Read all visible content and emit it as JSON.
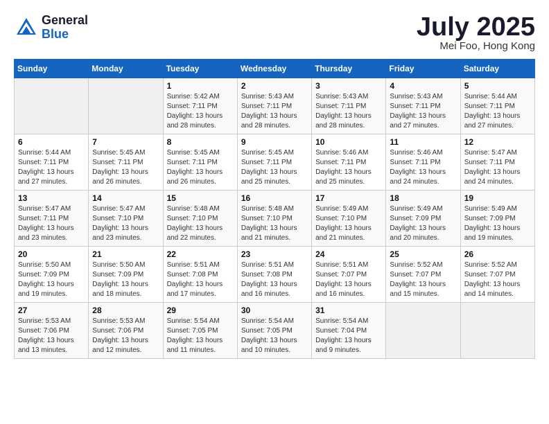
{
  "header": {
    "logo_general": "General",
    "logo_blue": "Blue",
    "month_title": "July 2025",
    "location": "Mei Foo, Hong Kong"
  },
  "weekdays": [
    "Sunday",
    "Monday",
    "Tuesday",
    "Wednesday",
    "Thursday",
    "Friday",
    "Saturday"
  ],
  "weeks": [
    [
      {
        "day": "",
        "info": ""
      },
      {
        "day": "",
        "info": ""
      },
      {
        "day": "1",
        "info": "Sunrise: 5:42 AM\nSunset: 7:11 PM\nDaylight: 13 hours and 28 minutes."
      },
      {
        "day": "2",
        "info": "Sunrise: 5:43 AM\nSunset: 7:11 PM\nDaylight: 13 hours and 28 minutes."
      },
      {
        "day": "3",
        "info": "Sunrise: 5:43 AM\nSunset: 7:11 PM\nDaylight: 13 hours and 28 minutes."
      },
      {
        "day": "4",
        "info": "Sunrise: 5:43 AM\nSunset: 7:11 PM\nDaylight: 13 hours and 27 minutes."
      },
      {
        "day": "5",
        "info": "Sunrise: 5:44 AM\nSunset: 7:11 PM\nDaylight: 13 hours and 27 minutes."
      }
    ],
    [
      {
        "day": "6",
        "info": "Sunrise: 5:44 AM\nSunset: 7:11 PM\nDaylight: 13 hours and 27 minutes."
      },
      {
        "day": "7",
        "info": "Sunrise: 5:45 AM\nSunset: 7:11 PM\nDaylight: 13 hours and 26 minutes."
      },
      {
        "day": "8",
        "info": "Sunrise: 5:45 AM\nSunset: 7:11 PM\nDaylight: 13 hours and 26 minutes."
      },
      {
        "day": "9",
        "info": "Sunrise: 5:45 AM\nSunset: 7:11 PM\nDaylight: 13 hours and 25 minutes."
      },
      {
        "day": "10",
        "info": "Sunrise: 5:46 AM\nSunset: 7:11 PM\nDaylight: 13 hours and 25 minutes."
      },
      {
        "day": "11",
        "info": "Sunrise: 5:46 AM\nSunset: 7:11 PM\nDaylight: 13 hours and 24 minutes."
      },
      {
        "day": "12",
        "info": "Sunrise: 5:47 AM\nSunset: 7:11 PM\nDaylight: 13 hours and 24 minutes."
      }
    ],
    [
      {
        "day": "13",
        "info": "Sunrise: 5:47 AM\nSunset: 7:11 PM\nDaylight: 13 hours and 23 minutes."
      },
      {
        "day": "14",
        "info": "Sunrise: 5:47 AM\nSunset: 7:10 PM\nDaylight: 13 hours and 23 minutes."
      },
      {
        "day": "15",
        "info": "Sunrise: 5:48 AM\nSunset: 7:10 PM\nDaylight: 13 hours and 22 minutes."
      },
      {
        "day": "16",
        "info": "Sunrise: 5:48 AM\nSunset: 7:10 PM\nDaylight: 13 hours and 21 minutes."
      },
      {
        "day": "17",
        "info": "Sunrise: 5:49 AM\nSunset: 7:10 PM\nDaylight: 13 hours and 21 minutes."
      },
      {
        "day": "18",
        "info": "Sunrise: 5:49 AM\nSunset: 7:09 PM\nDaylight: 13 hours and 20 minutes."
      },
      {
        "day": "19",
        "info": "Sunrise: 5:49 AM\nSunset: 7:09 PM\nDaylight: 13 hours and 19 minutes."
      }
    ],
    [
      {
        "day": "20",
        "info": "Sunrise: 5:50 AM\nSunset: 7:09 PM\nDaylight: 13 hours and 19 minutes."
      },
      {
        "day": "21",
        "info": "Sunrise: 5:50 AM\nSunset: 7:09 PM\nDaylight: 13 hours and 18 minutes."
      },
      {
        "day": "22",
        "info": "Sunrise: 5:51 AM\nSunset: 7:08 PM\nDaylight: 13 hours and 17 minutes."
      },
      {
        "day": "23",
        "info": "Sunrise: 5:51 AM\nSunset: 7:08 PM\nDaylight: 13 hours and 16 minutes."
      },
      {
        "day": "24",
        "info": "Sunrise: 5:51 AM\nSunset: 7:07 PM\nDaylight: 13 hours and 16 minutes."
      },
      {
        "day": "25",
        "info": "Sunrise: 5:52 AM\nSunset: 7:07 PM\nDaylight: 13 hours and 15 minutes."
      },
      {
        "day": "26",
        "info": "Sunrise: 5:52 AM\nSunset: 7:07 PM\nDaylight: 13 hours and 14 minutes."
      }
    ],
    [
      {
        "day": "27",
        "info": "Sunrise: 5:53 AM\nSunset: 7:06 PM\nDaylight: 13 hours and 13 minutes."
      },
      {
        "day": "28",
        "info": "Sunrise: 5:53 AM\nSunset: 7:06 PM\nDaylight: 13 hours and 12 minutes."
      },
      {
        "day": "29",
        "info": "Sunrise: 5:54 AM\nSunset: 7:05 PM\nDaylight: 13 hours and 11 minutes."
      },
      {
        "day": "30",
        "info": "Sunrise: 5:54 AM\nSunset: 7:05 PM\nDaylight: 13 hours and 10 minutes."
      },
      {
        "day": "31",
        "info": "Sunrise: 5:54 AM\nSunset: 7:04 PM\nDaylight: 13 hours and 9 minutes."
      },
      {
        "day": "",
        "info": ""
      },
      {
        "day": "",
        "info": ""
      }
    ]
  ]
}
